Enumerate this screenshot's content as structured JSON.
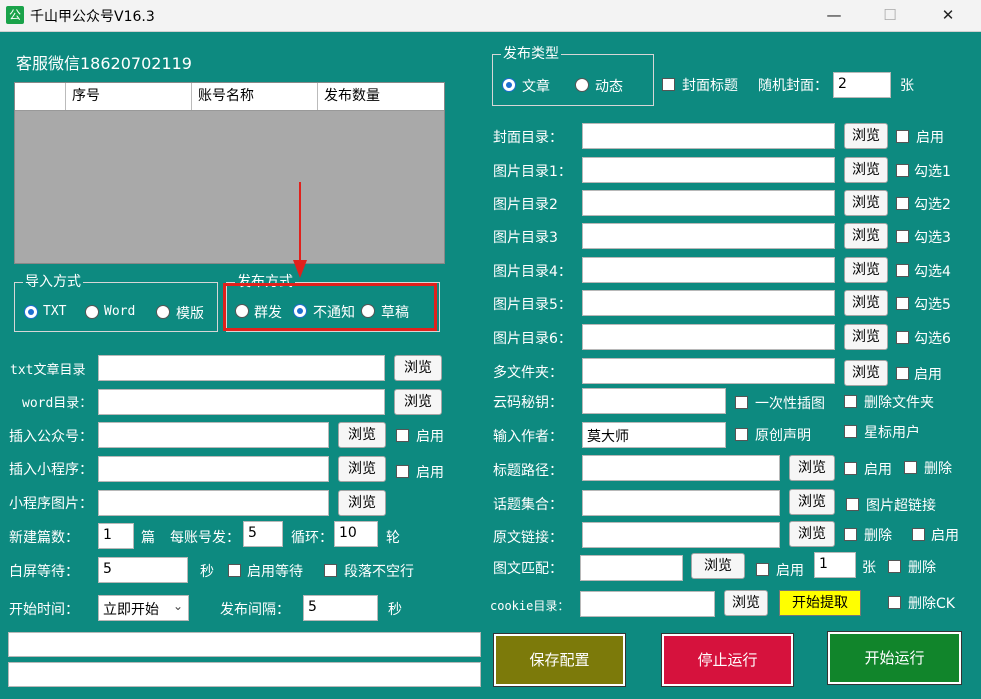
{
  "window": {
    "title": "千山甲公众号V16.3",
    "icon_text": "公",
    "minimize": "—",
    "maximize": "☐",
    "close": "✕"
  },
  "left": {
    "service_label": "客服微信18620702119",
    "table": {
      "headers": [
        "",
        "序号",
        "账号名称",
        "发布数量"
      ],
      "rows": []
    },
    "import": {
      "title": "导入方式",
      "options": [
        "TXT",
        "Word",
        "模版"
      ],
      "selected": "TXT"
    },
    "publish_mode": {
      "title": "发布方式",
      "options": [
        "群发",
        "不通知",
        "草稿"
      ],
      "selected": "不通知"
    },
    "txt_dir": {
      "label": "txt文章目录",
      "value": "",
      "browse": "浏览"
    },
    "word_dir": {
      "label": "word目录：",
      "value": "",
      "browse": "浏览"
    },
    "insert_account": {
      "label": "插入公众号：",
      "value": "",
      "browse": "浏览",
      "enable": "启用"
    },
    "insert_miniprogram": {
      "label": "插入小程序：",
      "value": "",
      "browse": "浏览",
      "enable": "启用"
    },
    "miniprogram_image": {
      "label": "小程序图片：",
      "value": "",
      "browse": "浏览"
    },
    "new_count": {
      "label": "新建篇数：",
      "value": "1",
      "unit": "篇"
    },
    "per_account": {
      "label": "每账号发：",
      "value": "5"
    },
    "loop": {
      "label": "循环：",
      "value": "10",
      "unit": "轮"
    },
    "white_wait": {
      "label": "白屏等待：",
      "value": "5",
      "unit": "秒",
      "enable_wait": "启用等待",
      "no_blank_line": "段落不空行"
    },
    "start_time": {
      "label": "开始时间：",
      "value": "立即开始"
    },
    "interval": {
      "label": "发布间隔：",
      "value": "5",
      "unit": "秒"
    },
    "log1": "",
    "log2": ""
  },
  "right": {
    "publish_type": {
      "title": "发布类型",
      "options": [
        "文章",
        "动态"
      ],
      "selected": "文章"
    },
    "cover_title": "封面标题",
    "random_cover": {
      "label": "随机封面：",
      "value": "2",
      "unit": "张"
    },
    "cover_dir": {
      "label": "封面目录：",
      "value": "",
      "browse": "浏览",
      "check": "启用"
    },
    "image_dirs": [
      {
        "label": "图片目录1：",
        "value": "",
        "browse": "浏览",
        "check": "勾选1"
      },
      {
        "label": "图片目录2",
        "value": "",
        "browse": "浏览",
        "check": "勾选2"
      },
      {
        "label": "图片目录3",
        "value": "",
        "browse": "浏览",
        "check": "勾选3"
      },
      {
        "label": "图片目录4：",
        "value": "",
        "browse": "浏览",
        "check": "勾选4"
      },
      {
        "label": "图片目录5：",
        "value": "",
        "browse": "浏览",
        "check": "勾选5"
      },
      {
        "label": "图片目录6：",
        "value": "",
        "browse": "浏览",
        "check": "勾选6"
      }
    ],
    "multi_folder": {
      "label": "多文件夹：",
      "value": "",
      "browse": "浏览",
      "check": "启用"
    },
    "cloud_key": {
      "label": "云码秘钥：",
      "value": "",
      "check1": "一次性插图",
      "check2": "删除文件夹"
    },
    "author": {
      "label": "输入作者：",
      "value": "莫大师",
      "check1": "原创声明",
      "check2": "星标用户"
    },
    "title_path": {
      "label": "标题路径：",
      "value": "",
      "browse": "浏览",
      "check1": "启用",
      "check2": "删除"
    },
    "topic_set": {
      "label": "话题集合：",
      "value": "",
      "browse": "浏览",
      "check1": "图片超链接"
    },
    "original_link": {
      "label": "原文链接：",
      "value": "",
      "browse": "浏览",
      "check1": "删除",
      "check2": "启用"
    },
    "image_match": {
      "label": "图文匹配：",
      "value": "",
      "browse": "浏览",
      "check1": "启用",
      "count": "1",
      "unit": "张",
      "check2": "删除"
    },
    "cookie_dir": {
      "label": "cookie目录：",
      "value": "",
      "browse": "浏览",
      "extract": "开始提取",
      "check": "删除CK"
    }
  },
  "actions": {
    "save": "保存配置",
    "stop": "停止运行",
    "start": "开始运行"
  },
  "colors": {
    "background": "#0d8a80",
    "save": "#7c7a0a",
    "stop": "#d6123d",
    "start": "#11852b",
    "highlight": "#e0211c",
    "extract": "#ffff00"
  }
}
